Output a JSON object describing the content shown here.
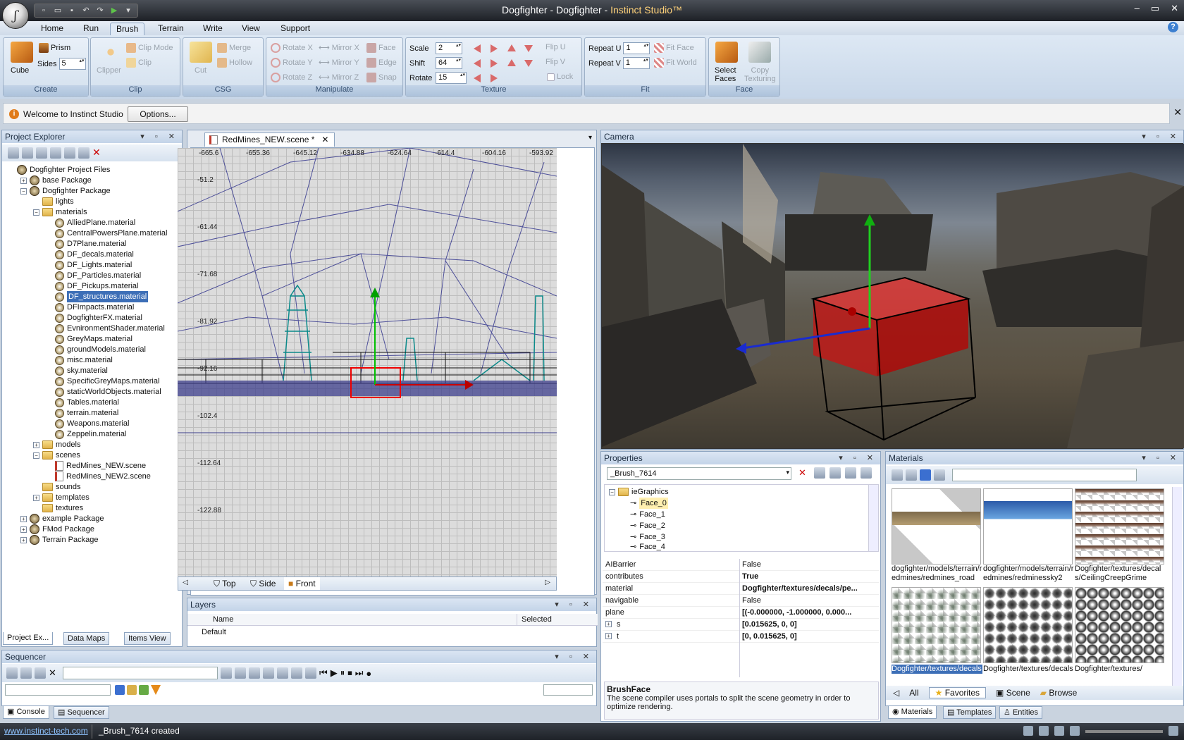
{
  "window": {
    "title": "Dogfighter - Dogfighter - ",
    "brand": "Instinct Studio™",
    "min": "‒",
    "max": "▭",
    "close": "✕"
  },
  "ribbon_tabs": [
    "Home",
    "Run",
    "Brush",
    "Terrain",
    "Write",
    "View",
    "Support"
  ],
  "ribbon": {
    "create": {
      "cube": "Cube",
      "prism": "Prism",
      "sides_label": "Sides",
      "sides_value": "5",
      "group": "Create"
    },
    "clip": {
      "clipper": "Clipper",
      "clip_mode": "Clip Mode",
      "clip": "Clip",
      "group": "Clip"
    },
    "csg": {
      "cut": "Cut",
      "merge": "Merge",
      "hollow": "Hollow",
      "group": "CSG"
    },
    "manipulate": {
      "rotate_x": "Rotate X",
      "rotate_y": "Rotate Y",
      "rotate_z": "Rotate Z",
      "mirror_x": "Mirror X",
      "mirror_y": "Mirror Y",
      "mirror_z": "Mirror Z",
      "face": "Face",
      "edge": "Edge",
      "snap": "Snap",
      "group": "Manipulate"
    },
    "texture": {
      "scale_label": "Scale",
      "scale_value": "2",
      "shift_label": "Shift",
      "shift_value": "64",
      "rotate_label": "Rotate",
      "rotate_value": "15",
      "flip_u": "Flip U",
      "flip_v": "Flip V",
      "lock": "Lock",
      "group": "Texture"
    },
    "fit": {
      "repeat_u_label": "Repeat U",
      "repeat_u_value": "1",
      "repeat_v_label": "Repeat V",
      "repeat_v_value": "1",
      "fit_face": "Fit Face",
      "fit_world": "Fit World",
      "group": "Fit"
    },
    "face": {
      "select_faces_1": "Select",
      "select_faces_2": "Faces",
      "copy_texturing_1": "Copy",
      "copy_texturing_2": "Texturing",
      "group": "Face"
    }
  },
  "infobar": {
    "text": "Welcome to Instinct Studio",
    "options": "Options...",
    "close": "✕"
  },
  "project_explorer": {
    "title": "Project Explorer",
    "root": "Dogfighter Project Files",
    "base_package": "base Package",
    "dogfighter_package": "Dogfighter Package",
    "lights": "lights",
    "materials_folder": "materials",
    "materials": [
      "AlliedPlane.material",
      "CentralPowersPlane.material",
      "D7Plane.material",
      "DF_decals.material",
      "DF_Lights.material",
      "DF_Particles.material",
      "DF_Pickups.material",
      "DF_structures.material",
      "DFImpacts.material",
      "DogfighterFX.material",
      "EvnironmentShader.material",
      "GreyMaps.material",
      "groundModels.material",
      "misc.material",
      "sky.material",
      "SpecificGreyMaps.material",
      "staticWorldObjects.material",
      "Tables.material",
      "terrain.material",
      "Weapons.material",
      "Zeppelin.material"
    ],
    "selected_material": "DF_structures.material",
    "models": "models",
    "scenes": "scenes",
    "scene_files": [
      "RedMines_NEW.scene",
      "RedMines_NEW2.scene"
    ],
    "sounds": "sounds",
    "templates": "templates",
    "textures": "textures",
    "example_package": "example Package",
    "fmod_package": "FMod Package",
    "terrain_package": "Terrain Package"
  },
  "left_tabs": {
    "project": "Project Ex...",
    "data_maps": "Data Maps",
    "items_view": "Items View"
  },
  "editor": {
    "tab_title": "RedMines_NEW.scene *",
    "x_coords": [
      "-665.6",
      "-655.36",
      "-645.12",
      "-634.88",
      "-624.64",
      "-614.4",
      "-604.16",
      "-593.92"
    ],
    "y_coords": [
      "-51.2",
      "-61.44",
      "-71.68",
      "-81.92",
      "-92.16",
      "-102.4",
      "-112.64",
      "-122.88"
    ],
    "view_tabs": [
      "Top",
      "Side",
      "Front"
    ]
  },
  "layers": {
    "title": "Layers",
    "col_name": "Name",
    "col_selected": "Selected",
    "row": "Default"
  },
  "sequencer": {
    "title": "Sequencer"
  },
  "bottom_tabs": {
    "console": "Console",
    "sequencer": "Sequencer"
  },
  "camera": {
    "title": "Camera"
  },
  "properties": {
    "title": "Properties",
    "object": "_Brush_7614",
    "tree_root": "ieGraphics",
    "faces": [
      "Face_0",
      "Face_1",
      "Face_2",
      "Face_3",
      "Face_4"
    ],
    "rows": [
      {
        "key": "AIBarrier",
        "value": "False",
        "bold": false
      },
      {
        "key": "contributes",
        "value": "True",
        "bold": true
      },
      {
        "key": "material",
        "value": "Dogfighter/textures/decals/pe...",
        "bold": true
      },
      {
        "key": "navigable",
        "value": "False",
        "bold": false
      },
      {
        "key": "plane",
        "value": "[(-0.000000, -1.000000, 0.000...",
        "bold": true
      },
      {
        "key": "s",
        "value": "[0.015625, 0, 0]",
        "bold": true
      },
      {
        "key": "t",
        "value": "[0, 0.015625, 0]",
        "bold": true
      }
    ],
    "desc_title": "BrushFace",
    "desc_text": "The scene compiler uses portals to split the scene geometry in order to optimize rendering."
  },
  "materials": {
    "title": "Materials",
    "thumbs": [
      "dogfighter/models/terrain/redmines/redmines_road",
      "dogfighter/models/terrain/redmines/redminessky2",
      "Dogfighter/textures/decals/CeilingCreepGrime",
      "Dogfighter/textures/decals",
      "Dogfighter/textures/decals",
      "Dogfighter/textures/"
    ],
    "tabs": [
      "All",
      "Favorites",
      "Scene",
      "Browse"
    ]
  },
  "right_bottom_tabs": {
    "materials": "Materials",
    "templates": "Templates",
    "entities": "Entities"
  },
  "status": {
    "link": "www.instinct-tech.com",
    "message": "_Brush_7614 created"
  }
}
